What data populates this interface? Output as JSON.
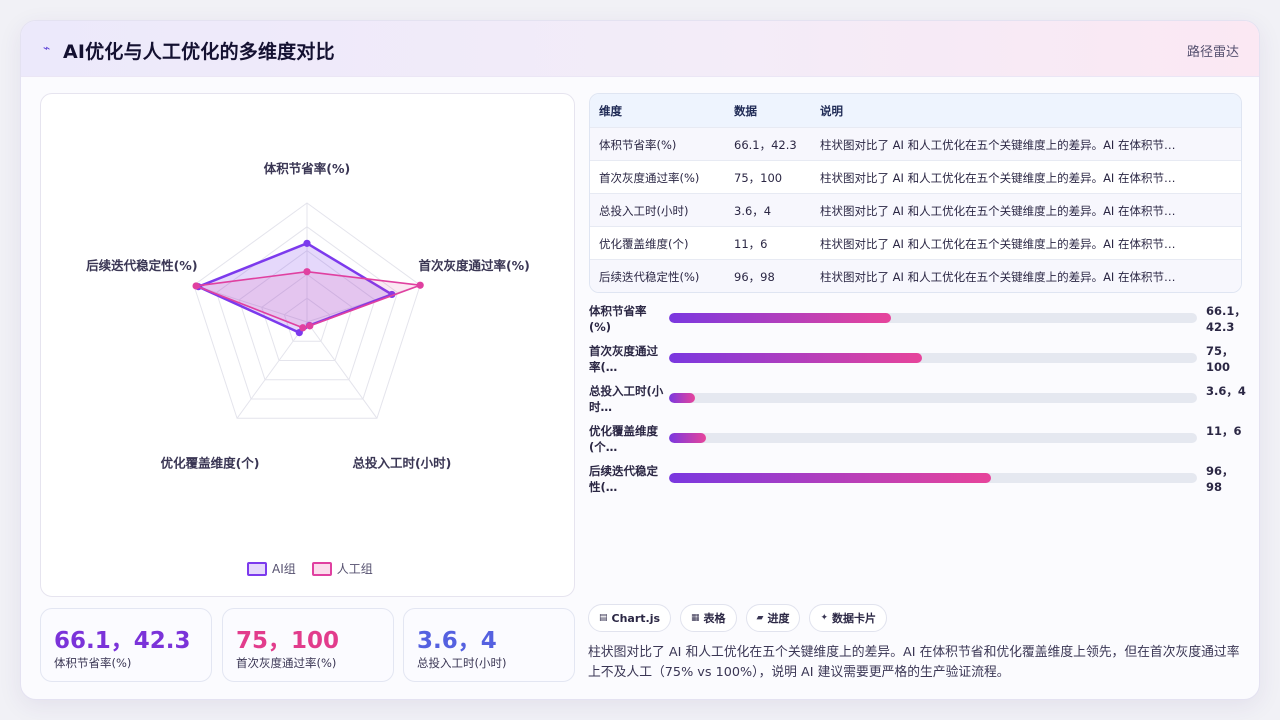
{
  "header": {
    "icon": "trend-line-icon",
    "title": "AI优化与人工优化的多维度对比",
    "route": "路径雷达"
  },
  "colors": {
    "ai": "#7c3aed",
    "human": "#e040a0",
    "stat1": "#7b33d9",
    "stat2": "#e23c8c",
    "stat3": "#5561e0"
  },
  "chart_data": {
    "type": "radar",
    "categories": [
      "体积节省率(%)",
      "首次灰度通过率(%)",
      "总投入工时(小时)",
      "优化覆盖维度(个)",
      "后续迭代稳定性(%)"
    ],
    "range": [
      0,
      100
    ],
    "grid": true,
    "legend_position": "bottom",
    "series": [
      {
        "name": "AI组",
        "values": [
          66.1,
          75,
          3.6,
          11,
          96
        ]
      },
      {
        "name": "人工组",
        "values": [
          42.3,
          100,
          4,
          6,
          98
        ]
      }
    ]
  },
  "legend": {
    "ai": "AI组",
    "human": "人工组"
  },
  "stats": [
    {
      "value": "66.1，42.3",
      "label": "体积节省率(%)"
    },
    {
      "value": "75，100",
      "label": "首次灰度通过率(%)"
    },
    {
      "value": "3.6，4",
      "label": "总投入工时(小时)"
    }
  ],
  "table": {
    "headers": [
      "维度",
      "数据",
      "说明"
    ],
    "rows": [
      {
        "dim": "体积节省率(%)",
        "data": "66.1，42.3",
        "desc": "柱状图对比了 AI 和人工优化在五个关键维度上的差异。AI 在体积节…"
      },
      {
        "dim": "首次灰度通过率(%)",
        "data": "75，100",
        "desc": "柱状图对比了 AI 和人工优化在五个关键维度上的差异。AI 在体积节…"
      },
      {
        "dim": "总投入工时(小时)",
        "data": "3.6，4",
        "desc": "柱状图对比了 AI 和人工优化在五个关键维度上的差异。AI 在体积节…"
      },
      {
        "dim": "优化覆盖维度(个)",
        "data": "11，6",
        "desc": "柱状图对比了 AI 和人工优化在五个关键维度上的差异。AI 在体积节…"
      },
      {
        "dim": "后续迭代稳定性(%)",
        "data": "96，98",
        "desc": "柱状图对比了 AI 和人工优化在五个关键维度上的差异。AI 在体积节…"
      }
    ]
  },
  "progress": [
    {
      "label": "体积节省率(%)",
      "value": "66.1，42.3",
      "fraction": 0.42
    },
    {
      "label": "首次灰度通过率(…",
      "value": "75，100",
      "fraction": 0.48
    },
    {
      "label": "总投入工时(小时…",
      "value": "3.6，4",
      "fraction": 0.05
    },
    {
      "label": "优化覆盖维度(个…",
      "value": "11，6",
      "fraction": 0.07
    },
    {
      "label": "后续迭代稳定性(…",
      "value": "96，98",
      "fraction": 0.61
    }
  ],
  "chips": [
    {
      "icon": "chart-icon",
      "label": "Chart.js"
    },
    {
      "icon": "table-icon",
      "label": "表格"
    },
    {
      "icon": "progress-icon",
      "label": "进度"
    },
    {
      "icon": "sparkle-icon",
      "label": "数据卡片"
    }
  ],
  "summary": "柱状图对比了 AI 和人工优化在五个关键维度上的差异。AI 在体积节省和优化覆盖维度上领先，但在首次灰度通过率上不及人工（75% vs 100%），说明 AI 建议需要更严格的生产验证流程。"
}
